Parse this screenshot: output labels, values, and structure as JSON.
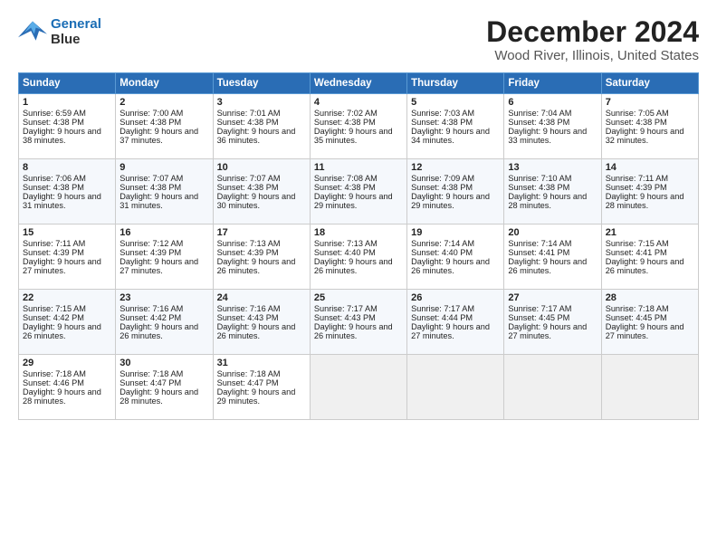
{
  "header": {
    "logo_line1": "General",
    "logo_line2": "Blue",
    "title": "December 2024",
    "subtitle": "Wood River, Illinois, United States"
  },
  "days_of_week": [
    "Sunday",
    "Monday",
    "Tuesday",
    "Wednesday",
    "Thursday",
    "Friday",
    "Saturday"
  ],
  "weeks": [
    [
      {
        "day": 1,
        "sunrise": "6:59 AM",
        "sunset": "4:38 PM",
        "daylight": "9 hours and 38 minutes."
      },
      {
        "day": 2,
        "sunrise": "7:00 AM",
        "sunset": "4:38 PM",
        "daylight": "9 hours and 37 minutes."
      },
      {
        "day": 3,
        "sunrise": "7:01 AM",
        "sunset": "4:38 PM",
        "daylight": "9 hours and 36 minutes."
      },
      {
        "day": 4,
        "sunrise": "7:02 AM",
        "sunset": "4:38 PM",
        "daylight": "9 hours and 35 minutes."
      },
      {
        "day": 5,
        "sunrise": "7:03 AM",
        "sunset": "4:38 PM",
        "daylight": "9 hours and 34 minutes."
      },
      {
        "day": 6,
        "sunrise": "7:04 AM",
        "sunset": "4:38 PM",
        "daylight": "9 hours and 33 minutes."
      },
      {
        "day": 7,
        "sunrise": "7:05 AM",
        "sunset": "4:38 PM",
        "daylight": "9 hours and 32 minutes."
      }
    ],
    [
      {
        "day": 8,
        "sunrise": "7:06 AM",
        "sunset": "4:38 PM",
        "daylight": "9 hours and 31 minutes."
      },
      {
        "day": 9,
        "sunrise": "7:07 AM",
        "sunset": "4:38 PM",
        "daylight": "9 hours and 31 minutes."
      },
      {
        "day": 10,
        "sunrise": "7:07 AM",
        "sunset": "4:38 PM",
        "daylight": "9 hours and 30 minutes."
      },
      {
        "day": 11,
        "sunrise": "7:08 AM",
        "sunset": "4:38 PM",
        "daylight": "9 hours and 29 minutes."
      },
      {
        "day": 12,
        "sunrise": "7:09 AM",
        "sunset": "4:38 PM",
        "daylight": "9 hours and 29 minutes."
      },
      {
        "day": 13,
        "sunrise": "7:10 AM",
        "sunset": "4:38 PM",
        "daylight": "9 hours and 28 minutes."
      },
      {
        "day": 14,
        "sunrise": "7:11 AM",
        "sunset": "4:39 PM",
        "daylight": "9 hours and 28 minutes."
      }
    ],
    [
      {
        "day": 15,
        "sunrise": "7:11 AM",
        "sunset": "4:39 PM",
        "daylight": "9 hours and 27 minutes."
      },
      {
        "day": 16,
        "sunrise": "7:12 AM",
        "sunset": "4:39 PM",
        "daylight": "9 hours and 27 minutes."
      },
      {
        "day": 17,
        "sunrise": "7:13 AM",
        "sunset": "4:39 PM",
        "daylight": "9 hours and 26 minutes."
      },
      {
        "day": 18,
        "sunrise": "7:13 AM",
        "sunset": "4:40 PM",
        "daylight": "9 hours and 26 minutes."
      },
      {
        "day": 19,
        "sunrise": "7:14 AM",
        "sunset": "4:40 PM",
        "daylight": "9 hours and 26 minutes."
      },
      {
        "day": 20,
        "sunrise": "7:14 AM",
        "sunset": "4:41 PM",
        "daylight": "9 hours and 26 minutes."
      },
      {
        "day": 21,
        "sunrise": "7:15 AM",
        "sunset": "4:41 PM",
        "daylight": "9 hours and 26 minutes."
      }
    ],
    [
      {
        "day": 22,
        "sunrise": "7:15 AM",
        "sunset": "4:42 PM",
        "daylight": "9 hours and 26 minutes."
      },
      {
        "day": 23,
        "sunrise": "7:16 AM",
        "sunset": "4:42 PM",
        "daylight": "9 hours and 26 minutes."
      },
      {
        "day": 24,
        "sunrise": "7:16 AM",
        "sunset": "4:43 PM",
        "daylight": "9 hours and 26 minutes."
      },
      {
        "day": 25,
        "sunrise": "7:17 AM",
        "sunset": "4:43 PM",
        "daylight": "9 hours and 26 minutes."
      },
      {
        "day": 26,
        "sunrise": "7:17 AM",
        "sunset": "4:44 PM",
        "daylight": "9 hours and 27 minutes."
      },
      {
        "day": 27,
        "sunrise": "7:17 AM",
        "sunset": "4:45 PM",
        "daylight": "9 hours and 27 minutes."
      },
      {
        "day": 28,
        "sunrise": "7:18 AM",
        "sunset": "4:45 PM",
        "daylight": "9 hours and 27 minutes."
      }
    ],
    [
      {
        "day": 29,
        "sunrise": "7:18 AM",
        "sunset": "4:46 PM",
        "daylight": "9 hours and 28 minutes."
      },
      {
        "day": 30,
        "sunrise": "7:18 AM",
        "sunset": "4:47 PM",
        "daylight": "9 hours and 28 minutes."
      },
      {
        "day": 31,
        "sunrise": "7:18 AM",
        "sunset": "4:47 PM",
        "daylight": "9 hours and 29 minutes."
      },
      null,
      null,
      null,
      null
    ]
  ]
}
